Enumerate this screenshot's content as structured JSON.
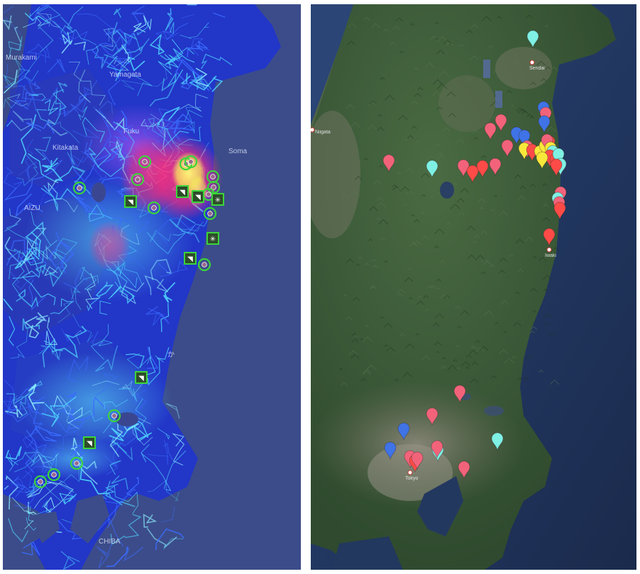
{
  "left_map": {
    "labels": {
      "murakami": "Murakami",
      "kitakata": "Kitakata",
      "soma": "Soma",
      "yamagata": "Yamagata",
      "fukushima": "Fuku",
      "aizu": "AIZU",
      "ka": "か",
      "chiba": "CHIBA"
    },
    "colors": {
      "ocean": "#3b4a86",
      "land": "#2a3dc4",
      "roads": "#4fd7ff",
      "hotspot_red": "#ff2e7a",
      "hotspot_yellow": "#f5f05a",
      "marker_green": "#3bd43b"
    },
    "marker_icons": [
      "radiation-sensor-icon",
      "wifi-sensor-icon",
      "snowflake-sensor-icon",
      "square-sensor-icon"
    ]
  },
  "right_map": {
    "labels": {
      "sendai": "Sendai",
      "niigata": "Niigata",
      "iwaki": "Iwaki",
      "tokyo": "Tokyo"
    },
    "colors": {
      "ocean": "#1f3560",
      "land": "#3d5a3a",
      "pin_red": "#ff4b47",
      "pin_pink": "#f2637a",
      "pin_blue": "#3f73e6",
      "pin_cyan": "#7ef0e4",
      "pin_yellow": "#f8e83a"
    },
    "pin_icon": "map-pin-icon"
  }
}
